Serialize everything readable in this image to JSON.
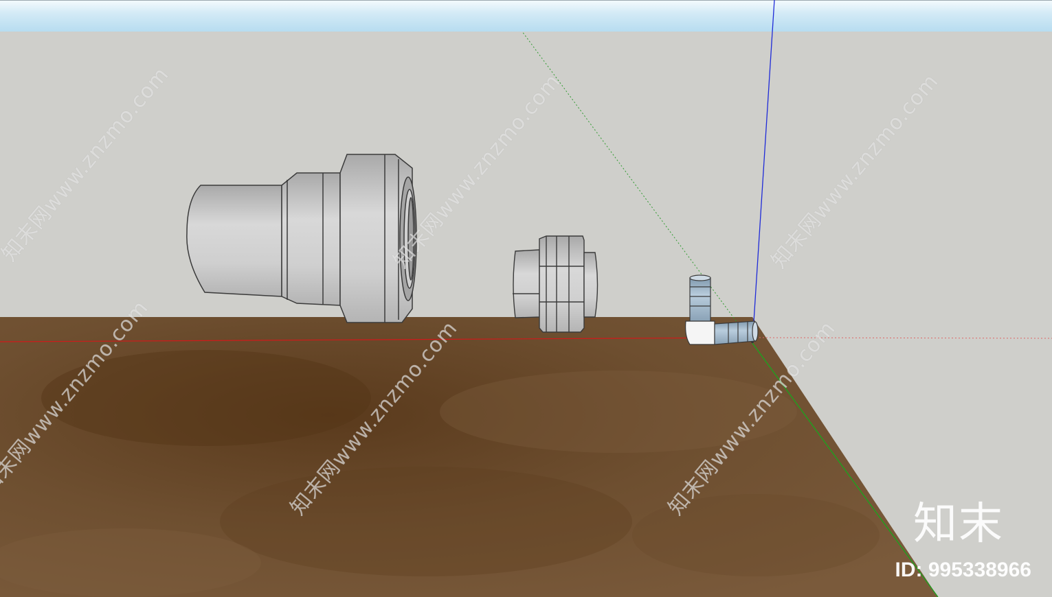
{
  "watermark": {
    "site_text": "知末网www.znzmo.com",
    "logo_text": "知末",
    "id_label": "ID: 995338966"
  },
  "colors": {
    "sky_top": "#f3fafd",
    "sky_bottom": "#b6dcf0",
    "wall": "#cfcfcb",
    "floor": "#6b4a2b",
    "axis_red": "#d11a1a",
    "axis_green": "#1fa01f",
    "axis_blue": "#1e2ad8",
    "part_grey": "#c9c9c9",
    "elbow_blue": "#9cb4c8"
  },
  "icons": [
    "axis-origin-icon"
  ]
}
